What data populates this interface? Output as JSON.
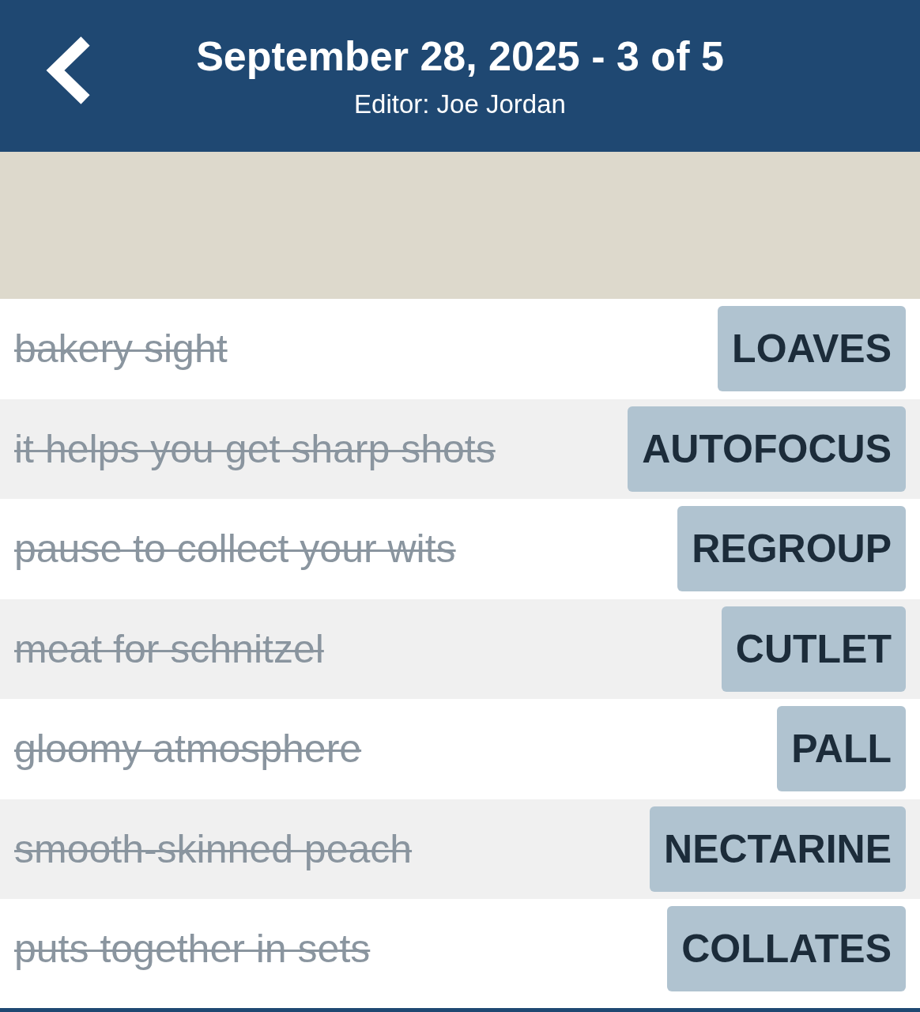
{
  "header": {
    "title": "September 28, 2025 - 3 of 5",
    "subtitle": "Editor: Joe Jordan"
  },
  "clues": [
    {
      "clue": "bakery sight",
      "answer": "LOAVES",
      "solved": true
    },
    {
      "clue": "it helps you get sharp shots",
      "answer": "AUTOFOCUS",
      "solved": true
    },
    {
      "clue": "pause to collect your wits",
      "answer": "REGROUP",
      "solved": true
    },
    {
      "clue": "meat for schnitzel",
      "answer": "CUTLET",
      "solved": true
    },
    {
      "clue": "gloomy atmosphere",
      "answer": "PALL",
      "solved": true
    },
    {
      "clue": "smooth-skinned peach",
      "answer": "NECTARINE",
      "solved": true
    },
    {
      "clue": "puts together in sets",
      "answer": "COLLATES",
      "solved": true
    }
  ]
}
